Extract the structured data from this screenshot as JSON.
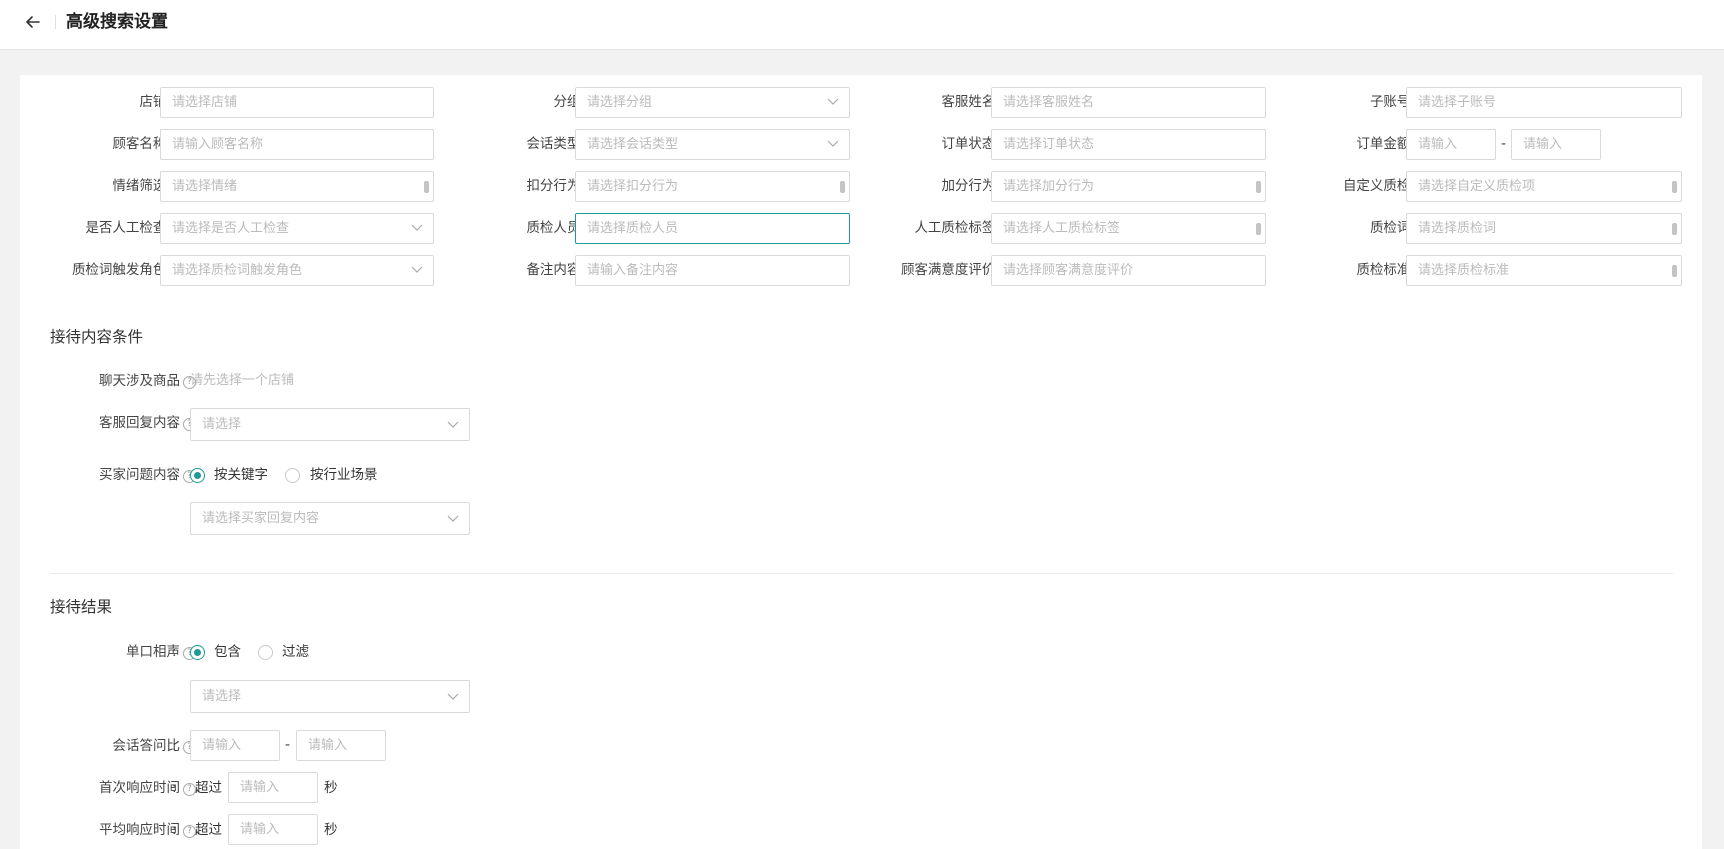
{
  "header": {
    "title": "高级搜索设置"
  },
  "filters": {
    "row1": [
      {
        "label": "店铺:",
        "placeholder": "请选择店铺"
      },
      {
        "label": "分组:",
        "placeholder": "请选择分组"
      },
      {
        "label": "客服姓名:",
        "placeholder": "请选择客服姓名"
      },
      {
        "label": "子账号:",
        "placeholder": "请选择子账号"
      }
    ],
    "row2": [
      {
        "label": "顾客名称:",
        "placeholder": "请输入顾客名称"
      },
      {
        "label": "会话类型:",
        "placeholder": "请选择会话类型"
      },
      {
        "label": "订单状态:",
        "placeholder": "请选择订单状态"
      },
      {
        "label": "订单金额:",
        "placeholder_min": "请输入",
        "placeholder_max": "请输入",
        "separator": "-"
      }
    ],
    "row3": [
      {
        "label": "情绪筛选:",
        "placeholder": "请选择情绪"
      },
      {
        "label": "扣分行为:",
        "placeholder": "请选择扣分行为"
      },
      {
        "label": "加分行为:",
        "placeholder": "请选择加分行为"
      },
      {
        "label": "自定义质检:",
        "placeholder": "请选择自定义质检项"
      }
    ],
    "row4": [
      {
        "label": "是否人工检查:",
        "placeholder": "请选择是否人工检查"
      },
      {
        "label": "质检人员:",
        "placeholder": "请选择质检人员"
      },
      {
        "label": "人工质检标签:",
        "placeholder": "请选择人工质检标签"
      },
      {
        "label": "质检词:",
        "placeholder": "请选择质检词"
      }
    ],
    "row5": [
      {
        "label": "质检词触发角色:",
        "placeholder": "请选择质检词触发角色"
      },
      {
        "label": "备注内容:",
        "placeholder": "请输入备注内容"
      },
      {
        "label": "顾客满意度评价:",
        "placeholder": "请选择顾客满意度评价"
      },
      {
        "label": "质检标准:",
        "placeholder": "请选择质检标准"
      }
    ]
  },
  "reception": {
    "title": "接待内容条件",
    "chat_goods": {
      "label": "聊天涉及商品",
      "colon": ":",
      "hint": "请先选择一个店铺"
    },
    "cs_reply": {
      "label": "客服回复内容",
      "colon": ":",
      "placeholder": "请选择"
    },
    "buyer_question": {
      "label": "买家问题内容",
      "colon": ":",
      "options": [
        "按关键字",
        "按行业场景"
      ],
      "selected": "按关键字",
      "placeholder": "请选择买家回复内容"
    }
  },
  "result": {
    "title": "接待结果",
    "single_crosstalk": {
      "label": "单口相声",
      "colon": ":",
      "options": [
        "包含",
        "过滤"
      ],
      "selected": "包含",
      "placeholder": "请选择"
    },
    "qa_ratio": {
      "label": "会话答问比",
      "colon": ":",
      "placeholder_min": "请输入",
      "placeholder_max": "请输入",
      "separator": "-"
    },
    "first_response": {
      "label": "首次响应时间",
      "colon": ":",
      "prefix": "超过",
      "placeholder": "请输入",
      "unit": "秒"
    },
    "avg_response": {
      "label": "平均响应时间",
      "colon": ":",
      "prefix": "超过",
      "placeholder": "请输入",
      "unit": "秒"
    }
  },
  "colors": {
    "accent": "#1d9a96",
    "border": "#d9d9d9",
    "placeholder": "#bbbbbb",
    "background": "#f2f2f2"
  },
  "icons": {
    "back": "arrow-left-icon",
    "dropdown": "chevron-down-icon",
    "help": "question-circle-icon",
    "scroll": "scrollbar-thumb"
  }
}
